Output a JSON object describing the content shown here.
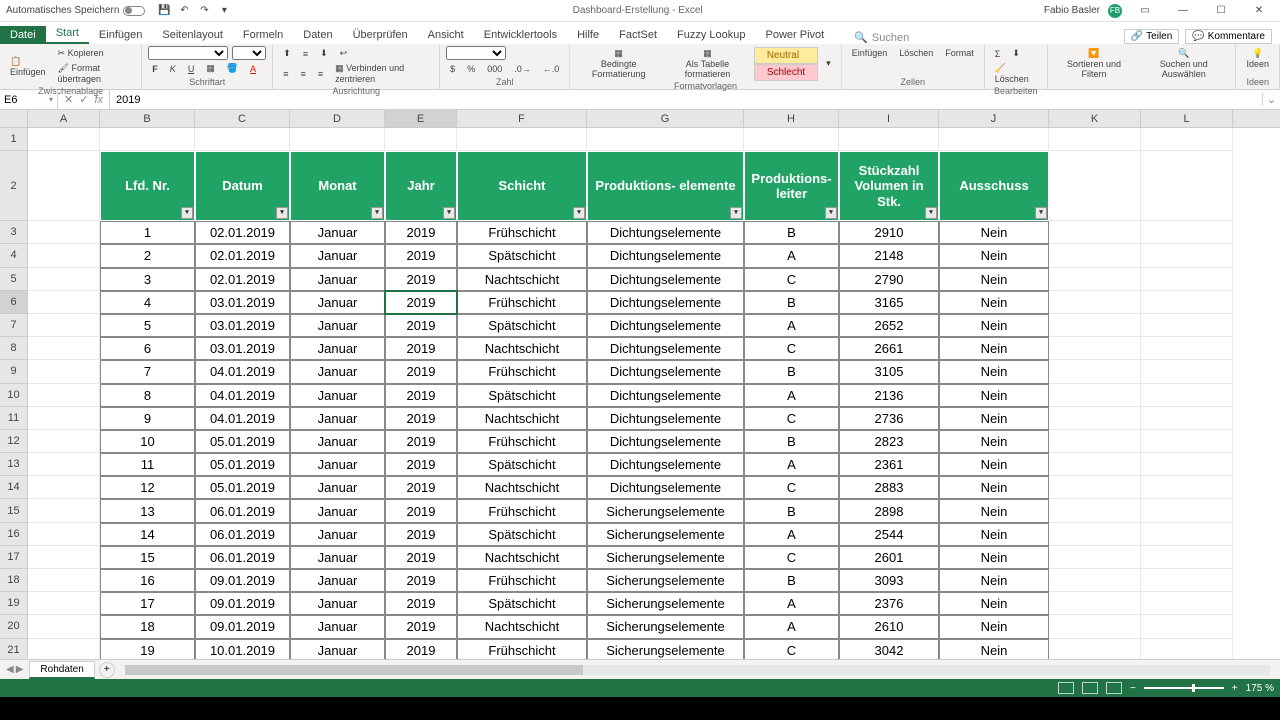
{
  "title": {
    "autosave": "Automatisches Speichern",
    "doc": "Dashboard-Erstellung - Excel",
    "user": "Fabio Basler",
    "avatar": "FB"
  },
  "qat": {
    "save": "💾",
    "undo": "↶",
    "redo": "↷"
  },
  "tabs": {
    "file": "Datei",
    "items": [
      "Start",
      "Einfügen",
      "Seitenlayout",
      "Formeln",
      "Daten",
      "Überprüfen",
      "Ansicht",
      "Entwicklertools",
      "Hilfe",
      "FactSet",
      "Fuzzy Lookup",
      "Power Pivot"
    ],
    "search_icon": "🔍",
    "search": "Suchen",
    "share": "Teilen",
    "comments": "Kommentare"
  },
  "ribbon": {
    "paste": "Einfügen",
    "copy": "Kopieren",
    "format_painter": "Format übertragen",
    "clipboard": "Zwischenablage",
    "font": "Schriftart",
    "bold": "F",
    "italic": "K",
    "underline": "U",
    "align": "Ausrichtung",
    "merge": "Verbinden und zentrieren",
    "number": "Zahl",
    "cond": "Bedingte Formatierung",
    "astable": "Als Tabelle formatieren",
    "neutral": "Neutral",
    "schlecht": "Schlecht",
    "styles": "Formatvorlagen",
    "insert": "Einfügen",
    "delete": "Löschen",
    "format": "Format",
    "cells": "Zellen",
    "clear": "Löschen",
    "edit": "Bearbeiten",
    "sort": "Sortieren und Filtern",
    "find": "Suchen und Auswählen",
    "ideas": "Ideen"
  },
  "fbar": {
    "name": "E6",
    "fx": "fx",
    "value": "2019"
  },
  "cols": [
    "A",
    "B",
    "C",
    "D",
    "E",
    "F",
    "G",
    "H",
    "I",
    "J",
    "K",
    "L"
  ],
  "headers": [
    "Lfd. Nr.",
    "Datum",
    "Monat",
    "Jahr",
    "Schicht",
    "Produktions-\nelemente",
    "Produktions-\nleiter",
    "Stückzahl Volumen in Stk.",
    "Ausschuss"
  ],
  "rows": [
    [
      1,
      "02.01.2019",
      "Januar",
      "2019",
      "Frühschicht",
      "Dichtungselemente",
      "B",
      "2910",
      "Nein"
    ],
    [
      2,
      "02.01.2019",
      "Januar",
      "2019",
      "Spätschicht",
      "Dichtungselemente",
      "A",
      "2148",
      "Nein"
    ],
    [
      3,
      "02.01.2019",
      "Januar",
      "2019",
      "Nachtschicht",
      "Dichtungselemente",
      "C",
      "2790",
      "Nein"
    ],
    [
      4,
      "03.01.2019",
      "Januar",
      "2019",
      "Frühschicht",
      "Dichtungselemente",
      "B",
      "3165",
      "Nein"
    ],
    [
      5,
      "03.01.2019",
      "Januar",
      "2019",
      "Spätschicht",
      "Dichtungselemente",
      "A",
      "2652",
      "Nein"
    ],
    [
      6,
      "03.01.2019",
      "Januar",
      "2019",
      "Nachtschicht",
      "Dichtungselemente",
      "C",
      "2661",
      "Nein"
    ],
    [
      7,
      "04.01.2019",
      "Januar",
      "2019",
      "Frühschicht",
      "Dichtungselemente",
      "B",
      "3105",
      "Nein"
    ],
    [
      8,
      "04.01.2019",
      "Januar",
      "2019",
      "Spätschicht",
      "Dichtungselemente",
      "A",
      "2136",
      "Nein"
    ],
    [
      9,
      "04.01.2019",
      "Januar",
      "2019",
      "Nachtschicht",
      "Dichtungselemente",
      "C",
      "2736",
      "Nein"
    ],
    [
      10,
      "05.01.2019",
      "Januar",
      "2019",
      "Frühschicht",
      "Dichtungselemente",
      "B",
      "2823",
      "Nein"
    ],
    [
      11,
      "05.01.2019",
      "Januar",
      "2019",
      "Spätschicht",
      "Dichtungselemente",
      "A",
      "2361",
      "Nein"
    ],
    [
      12,
      "05.01.2019",
      "Januar",
      "2019",
      "Nachtschicht",
      "Dichtungselemente",
      "C",
      "2883",
      "Nein"
    ],
    [
      13,
      "06.01.2019",
      "Januar",
      "2019",
      "Frühschicht",
      "Sicherungselemente",
      "B",
      "2898",
      "Nein"
    ],
    [
      14,
      "06.01.2019",
      "Januar",
      "2019",
      "Spätschicht",
      "Sicherungselemente",
      "A",
      "2544",
      "Nein"
    ],
    [
      15,
      "06.01.2019",
      "Januar",
      "2019",
      "Nachtschicht",
      "Sicherungselemente",
      "C",
      "2601",
      "Nein"
    ],
    [
      16,
      "09.01.2019",
      "Januar",
      "2019",
      "Frühschicht",
      "Sicherungselemente",
      "B",
      "3093",
      "Nein"
    ],
    [
      17,
      "09.01.2019",
      "Januar",
      "2019",
      "Spätschicht",
      "Sicherungselemente",
      "A",
      "2376",
      "Nein"
    ],
    [
      18,
      "09.01.2019",
      "Januar",
      "2019",
      "Nachtschicht",
      "Sicherungselemente",
      "A",
      "2610",
      "Nein"
    ],
    [
      19,
      "10.01.2019",
      "Januar",
      "2019",
      "Frühschicht",
      "Sicherungselemente",
      "C",
      "3042",
      "Nein"
    ]
  ],
  "sheet": {
    "name": "Rohdaten",
    "add": "+"
  },
  "status": {
    "ready": "",
    "zoom": "175 %"
  },
  "selected": {
    "row": 6,
    "col": "E"
  }
}
